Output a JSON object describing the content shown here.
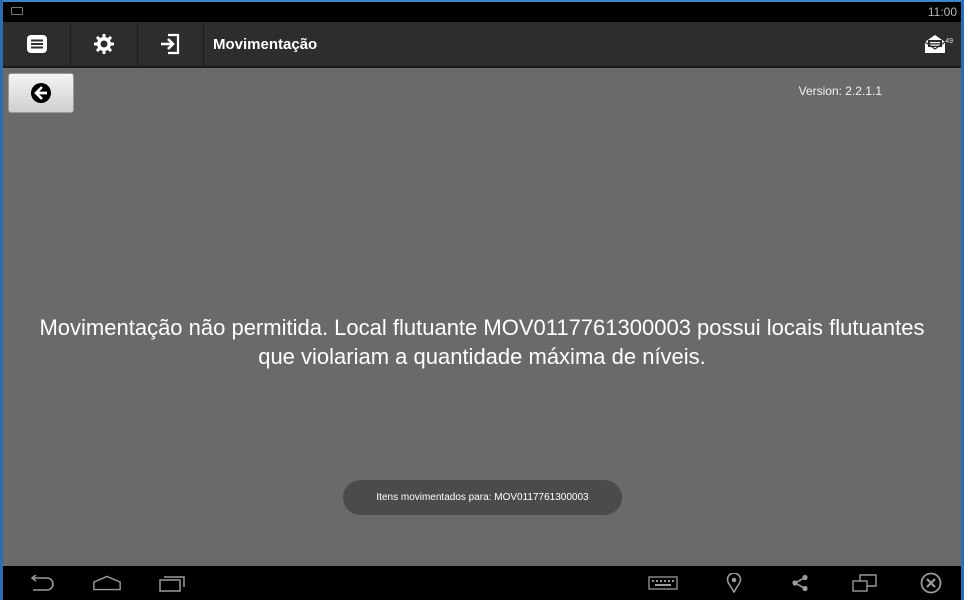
{
  "status_bar": {
    "time": "11:00"
  },
  "action_bar": {
    "title": "Movimentação",
    "mail_count": "49"
  },
  "content": {
    "version": "Version: 2.2.1.1",
    "message": "Movimentação não permitida. Local flutuante MOV0117761300003 possui locais flutuantes que violariam a quantidade máxima de níveis.",
    "toast": "Itens movimentados para: MOV0117761300003"
  },
  "icons": {
    "menu": "menu-icon",
    "settings": "gear-icon",
    "login": "login-icon",
    "mail": "mail-icon",
    "back": "back-arrow-icon",
    "nav_back": "back-icon",
    "nav_home": "home-icon",
    "nav_recent": "recent-apps-icon",
    "keyboard": "keyboard-icon",
    "location": "location-icon",
    "share": "share-icon",
    "window": "window-icon",
    "close": "close-icon"
  },
  "colors": {
    "background": "#6a6a6a",
    "action_bar": "#2d2d2d",
    "status_bar": "#000000",
    "toast": "#4b4b4b"
  }
}
